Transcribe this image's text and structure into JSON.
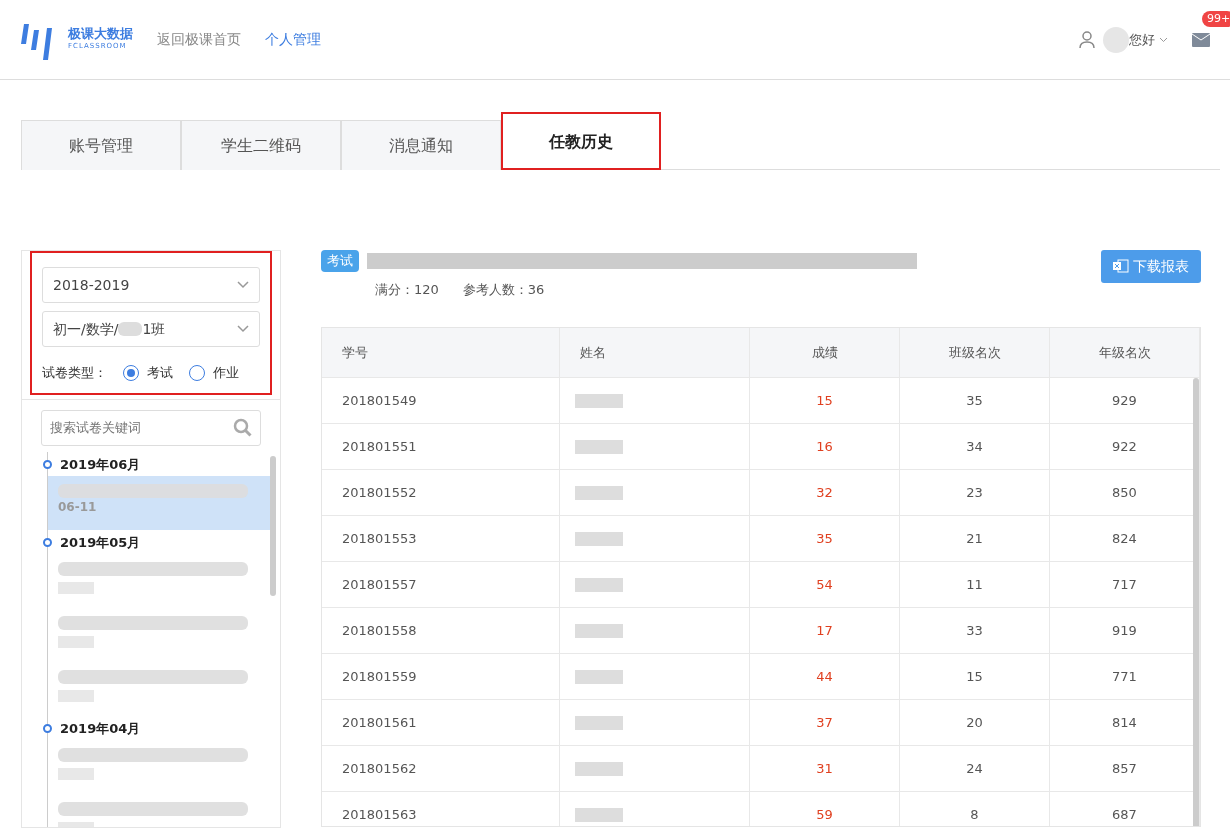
{
  "header": {
    "logo_title": "极课大数据",
    "logo_subtitle": "FCLASSROOM",
    "nav": [
      {
        "label": "返回极课首页",
        "selected": false
      },
      {
        "label": "个人管理",
        "selected": true
      }
    ],
    "greeting": "您好",
    "badge": "99+"
  },
  "tabs": [
    {
      "label": "账号管理",
      "selected": false,
      "highlighted": false
    },
    {
      "label": "学生二维码",
      "selected": false,
      "highlighted": false
    },
    {
      "label": "消息通知",
      "selected": false,
      "highlighted": false
    },
    {
      "label": "任教历史",
      "selected": true,
      "highlighted": true
    }
  ],
  "filters": {
    "highlighted": true,
    "year": "2018-2019",
    "class": "初一/数学/",
    "class_suffix": "1班",
    "type_label": "试卷类型：",
    "types": [
      {
        "label": "考试",
        "selected": true
      },
      {
        "label": "作业",
        "selected": false
      }
    ],
    "search": {
      "placeholder": "搜索试卷关键词"
    }
  },
  "timeline": [
    {
      "month": "2019年06月",
      "items": [
        {
          "selected": true,
          "date": "06-11"
        }
      ]
    },
    {
      "month": "2019年05月",
      "items": [
        {
          "selected": false
        },
        {
          "selected": false
        },
        {
          "selected": false
        }
      ]
    },
    {
      "month": "2019年04月",
      "items": [
        {
          "selected": false
        },
        {
          "selected": false
        }
      ]
    }
  ],
  "exam": {
    "tag": "考试",
    "full_score": "满分：120",
    "participants": "参考人数：36",
    "download": "下载报表"
  },
  "table": {
    "columns": [
      "学号",
      "姓名",
      "成绩",
      "班级名次",
      "年级名次"
    ],
    "rows": [
      {
        "id": "201801549",
        "score": "15",
        "class_rank": "35",
        "grade_rank": "929"
      },
      {
        "id": "201801551",
        "score": "16",
        "class_rank": "34",
        "grade_rank": "922"
      },
      {
        "id": "201801552",
        "score": "32",
        "class_rank": "23",
        "grade_rank": "850"
      },
      {
        "id": "201801553",
        "score": "35",
        "class_rank": "21",
        "grade_rank": "824"
      },
      {
        "id": "201801557",
        "score": "54",
        "class_rank": "11",
        "grade_rank": "717"
      },
      {
        "id": "201801558",
        "score": "17",
        "class_rank": "33",
        "grade_rank": "919"
      },
      {
        "id": "201801559",
        "score": "44",
        "class_rank": "15",
        "grade_rank": "771"
      },
      {
        "id": "201801561",
        "score": "37",
        "class_rank": "20",
        "grade_rank": "814"
      },
      {
        "id": "201801562",
        "score": "31",
        "class_rank": "24",
        "grade_rank": "857"
      },
      {
        "id": "201801563",
        "score": "59",
        "class_rank": "8",
        "grade_rank": "687"
      }
    ]
  }
}
